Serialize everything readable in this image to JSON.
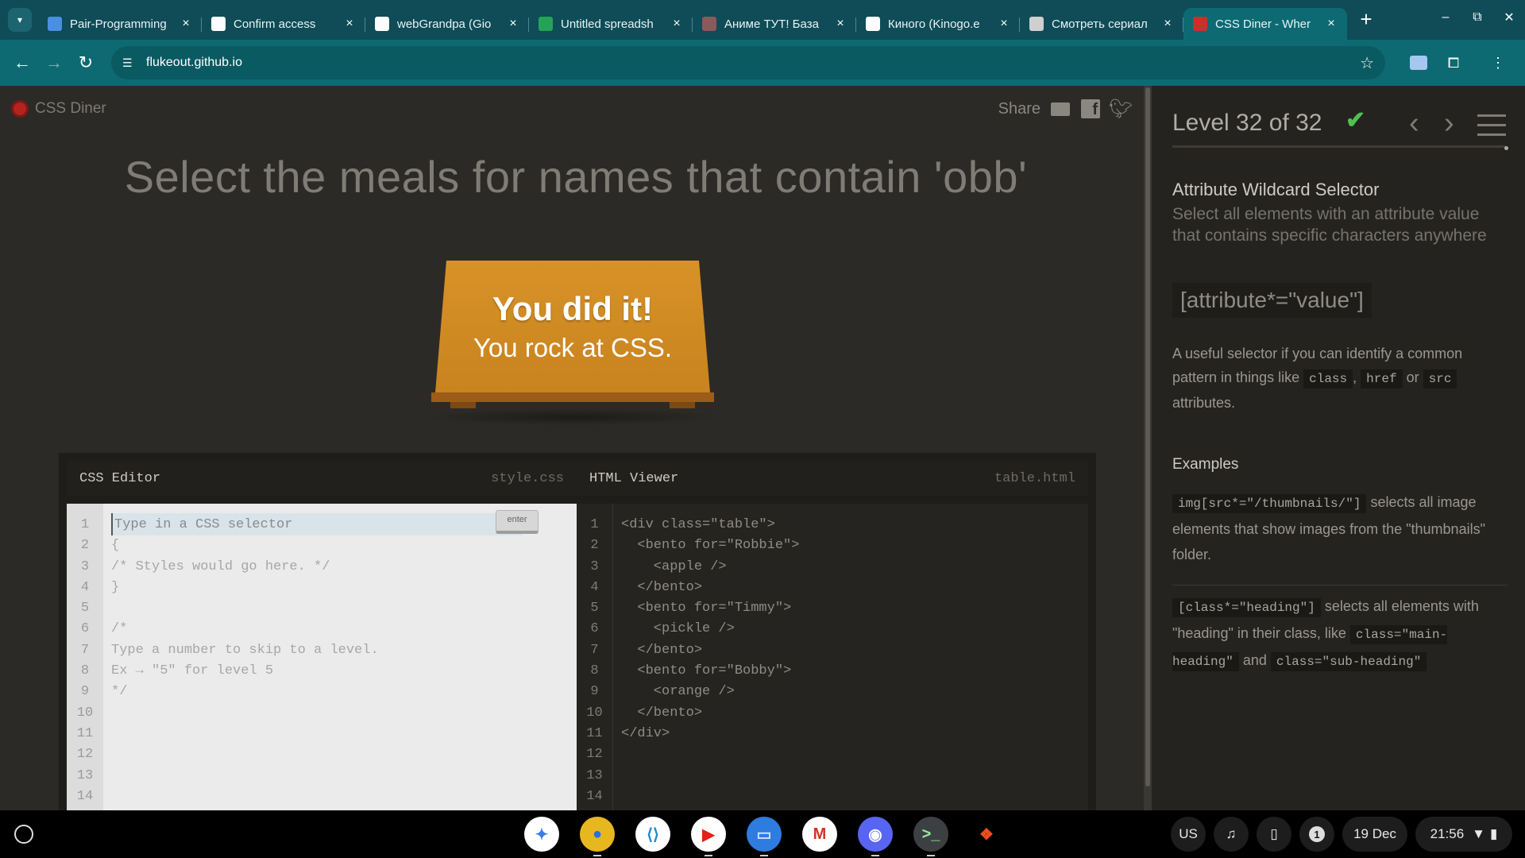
{
  "browser": {
    "tabs": [
      {
        "title": "Pair-Programming",
        "favicon": "monitor-icon",
        "color": "#4a8fe0"
      },
      {
        "title": "Confirm access",
        "favicon": "github-icon",
        "color": "#ffffff"
      },
      {
        "title": "webGrandpa (Gio",
        "favicon": "github-icon",
        "color": "#ffffff"
      },
      {
        "title": "Untitled spreadsh",
        "favicon": "sheets-icon",
        "color": "#23a455"
      },
      {
        "title": "Аниме ТУТ! База",
        "favicon": "anime-icon",
        "color": "#8a5a5a"
      },
      {
        "title": "Киного (Kinogo.e",
        "favicon": "kinogo-icon",
        "color": "#ffffff"
      },
      {
        "title": "Смотреть сериал",
        "favicon": "hd-icon",
        "color": "#cfcfcf"
      },
      {
        "title": "CSS Diner - Wher",
        "favicon": "diner-icon",
        "color": "#c9302c",
        "active": true
      }
    ],
    "url": "flukeout.github.io"
  },
  "page": {
    "logo_text": "CSS Diner",
    "share_label": "Share",
    "order": "Select the meals for names that contain 'obb'",
    "table_win_big": "You did it!",
    "table_win_small": "You rock at CSS.",
    "css_editor": {
      "title": "CSS Editor",
      "file": "style.css",
      "placeholder": "Type in a CSS selector",
      "enter_label": "enter",
      "lines": [
        "",
        "{",
        "/* Styles would go here. */",
        "}",
        "",
        "/*",
        "Type a number to skip to a level.",
        "Ex → \"5\" for level 5",
        "*/",
        "",
        "",
        "",
        "",
        ""
      ],
      "line_numbers": [
        "1",
        "2",
        "3",
        "4",
        "5",
        "6",
        "7",
        "8",
        "9",
        "10",
        "11",
        "12",
        "13",
        "14"
      ]
    },
    "html_viewer": {
      "title": "HTML Viewer",
      "file": "table.html",
      "lines": [
        "<div class=\"table\">",
        "  <bento for=\"Robbie\">",
        "    <apple />",
        "  </bento>",
        "  <bento for=\"Timmy\">",
        "    <pickle />",
        "  </bento>",
        "  <bento for=\"Bobby\">",
        "    <orange />",
        "  </bento>",
        "</div>",
        "",
        "",
        ""
      ],
      "line_numbers": [
        "1",
        "2",
        "3",
        "4",
        "5",
        "6",
        "7",
        "8",
        "9",
        "10",
        "11",
        "12",
        "13",
        "14"
      ]
    }
  },
  "sidebar": {
    "level": "Level 32 of 32",
    "completed": true,
    "title": "Attribute Wildcard Selector",
    "subtitle": "Select all elements with an attribute value that contains specific characters anywhere",
    "syntax": "[attribute*=\"value\"]",
    "hint_a": "A useful selector if you can identify a common pattern in things like",
    "hint_code1": "class",
    "hint_sep": ",",
    "hint_code2": "href",
    "hint_or": "or",
    "hint_code3": "src",
    "hint_b": "attributes.",
    "examples_title": "Examples",
    "ex1_code": "img[src*=\"/thumbnails/\"]",
    "ex1_text": "selects all image elements that show images from the \"thumbnails\" folder.",
    "ex2_code": "[class*=\"heading\"]",
    "ex2_text": "selects all elements with \"heading\" in their class, like",
    "ex2_code2": "class=\"main-heading\"",
    "ex2_and": "and",
    "ex2_code3": "class=\"sub-heading\""
  },
  "shelf": {
    "apps": [
      {
        "name": "gemini-icon",
        "color": "#ffffff",
        "glyph": "✦",
        "fg": "#3b7be8"
      },
      {
        "name": "chrome-icon",
        "color": "#e6b71e",
        "glyph": "●",
        "fg": "#2a6ee0"
      },
      {
        "name": "vscode-icon",
        "color": "#ffffff",
        "glyph": "⟨⟩",
        "fg": "#1f8ad2"
      },
      {
        "name": "youtube-icon",
        "color": "#ffffff",
        "glyph": "▶",
        "fg": "#e62117"
      },
      {
        "name": "files-icon",
        "color": "#2f7ce0",
        "glyph": "▭",
        "fg": "#cfe3ff"
      },
      {
        "name": "gmail-icon",
        "color": "#ffffff",
        "glyph": "M",
        "fg": "#d93025"
      },
      {
        "name": "discord-icon",
        "color": "#5865f2",
        "glyph": "◉",
        "fg": "#ffffff"
      },
      {
        "name": "terminal-icon",
        "color": "#3c4043",
        "glyph": ">_",
        "fg": "#9be7a0"
      },
      {
        "name": "figma-icon",
        "color": "#000000",
        "glyph": "❖",
        "fg": "#f24e1e"
      }
    ],
    "lang": "US",
    "notifications": "1",
    "date": "19 Dec",
    "time": "21:56"
  }
}
